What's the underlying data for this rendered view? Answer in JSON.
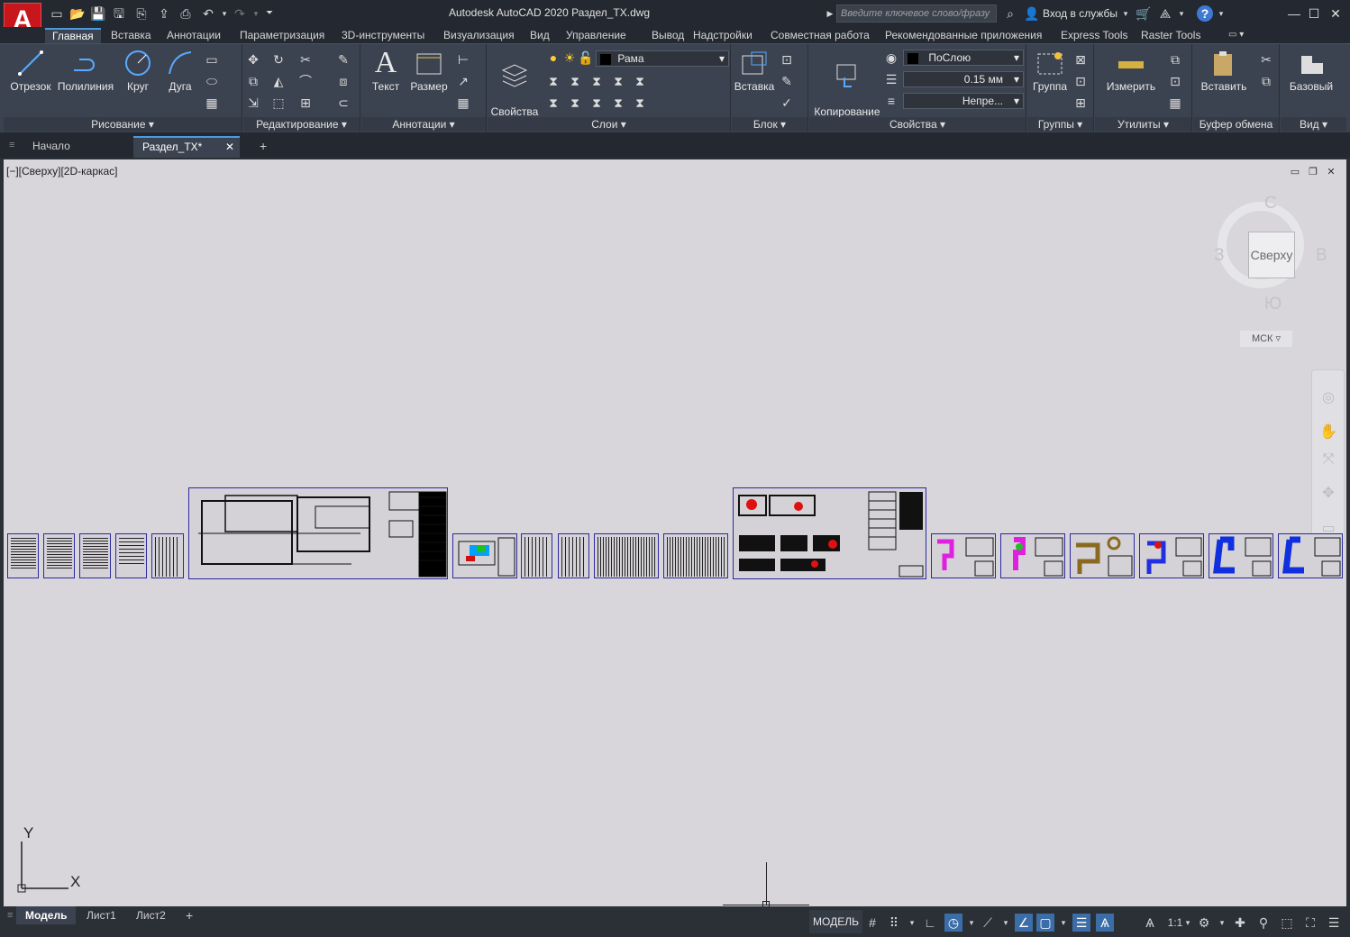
{
  "window": {
    "title": "Autodesk AutoCAD 2020    Раздел_ТХ.dwg",
    "search_placeholder": "Введите ключевое слово/фразу",
    "signin_label": "Вход в службы",
    "logo_letter": "A"
  },
  "ribbon_tabs": [
    "Главная",
    "Вставка",
    "Аннотации",
    "Параметризация",
    "3D-инструменты",
    "Визуализация",
    "Вид",
    "Управление",
    "Вывод",
    "Надстройки",
    "Совместная работа",
    "Рекомендованные приложения",
    "Express Tools",
    "Raster Tools"
  ],
  "ribbon": {
    "draw": {
      "title": "Рисование",
      "line": "Отрезок",
      "polyline": "Полилиния",
      "circle": "Круг",
      "arc": "Дуга"
    },
    "modify": {
      "title": "Редактирование"
    },
    "annotation": {
      "title": "Аннотации",
      "text": "Текст",
      "dimension": "Размер"
    },
    "layers": {
      "title": "Слои",
      "props": "Свойства\nслоя",
      "current_layer": "Рама"
    },
    "block": {
      "title": "Блок",
      "insert": "Вставка"
    },
    "properties": {
      "title": "Свойства",
      "match": "Копирование\nсвойств",
      "color": "ПоСлою",
      "lineweight": "0.15 мм",
      "linetype": "Непре..."
    },
    "groups": {
      "title": "Группы",
      "group": "Группа"
    },
    "utilities": {
      "title": "Утилиты",
      "measure": "Измерить"
    },
    "clipboard": {
      "title": "Буфер обмена",
      "paste": "Вставить"
    },
    "view": {
      "title": "Вид",
      "base": "Базовый"
    }
  },
  "file_tabs": {
    "home": "Начало",
    "active": "Раздел_ТХ*",
    "add": "+"
  },
  "viewport": {
    "label": "[−][Сверху][2D-каркас]",
    "viewcube_face": "Сверху",
    "compass": {
      "n": "С",
      "s": "Ю",
      "e": "В",
      "w": "З"
    },
    "ucs": "МСК",
    "axis_x": "X",
    "axis_y": "Y"
  },
  "layout_tabs": [
    "Модель",
    "Лист1",
    "Лист2"
  ],
  "status": {
    "model": "МОДЕЛЬ",
    "scale": "1:1"
  },
  "colors": {
    "accent": "#4b9ae0",
    "sheet_border": "#2c2aa0",
    "canvas": "#d8d6da"
  }
}
